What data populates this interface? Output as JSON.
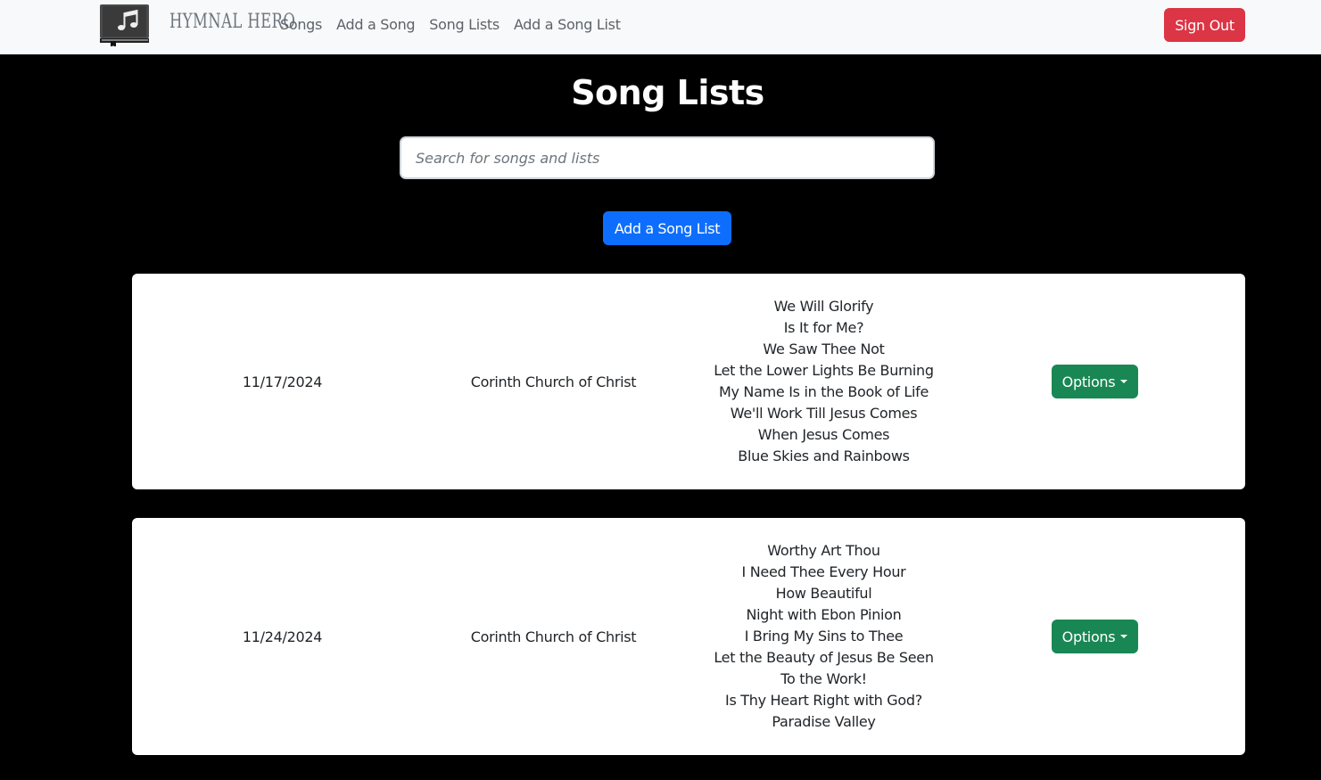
{
  "navbar": {
    "brand": "HYMNAL HERO",
    "links": [
      "Songs",
      "Add a Song",
      "Song Lists",
      "Add a Song List"
    ],
    "sign_out": "Sign Out"
  },
  "page": {
    "title": "Song Lists",
    "search_placeholder": "Search for songs and lists",
    "add_button": "Add a Song List"
  },
  "song_lists": [
    {
      "date": "11/17/2024",
      "church": "Corinth Church of Christ",
      "songs": [
        "We Will Glorify",
        "Is It for Me?",
        "We Saw Thee Not",
        "Let the Lower Lights Be Burning",
        "My Name Is in the Book of Life",
        "We'll Work Till Jesus Comes",
        "When Jesus Comes",
        "Blue Skies and Rainbows"
      ],
      "options_label": "Options"
    },
    {
      "date": "11/24/2024",
      "church": "Corinth Church of Christ",
      "songs": [
        "Worthy Art Thou",
        "I Need Thee Every Hour",
        "How Beautiful",
        "Night with Ebon Pinion",
        "I Bring My Sins to Thee",
        "Let the Beauty of Jesus Be Seen",
        "To the Work!",
        "Is Thy Heart Right with God?",
        "Paradise Valley"
      ],
      "options_label": "Options"
    }
  ],
  "colors": {
    "navbar_bg": "#f8f9fa",
    "page_bg": "#000000",
    "sign_out": "#dc3545",
    "primary": "#0d6efd",
    "options": "#198754"
  }
}
